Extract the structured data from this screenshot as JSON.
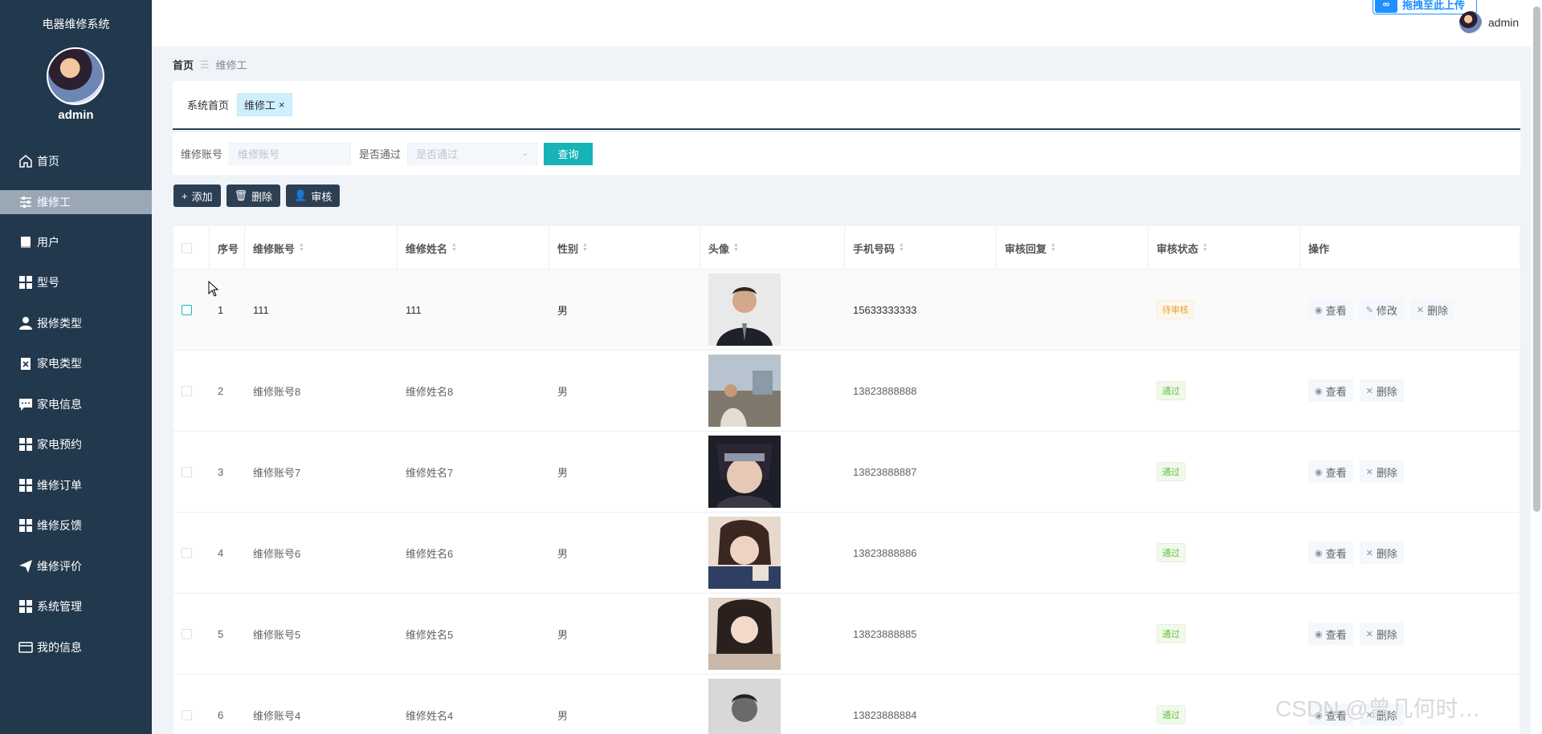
{
  "sidebar": {
    "title": "电器维修系统",
    "username": "admin",
    "items": [
      {
        "label": "首页",
        "icon": "home-icon"
      },
      {
        "label": "维修工",
        "icon": "sliders-icon"
      },
      {
        "label": "用户",
        "icon": "book-icon"
      },
      {
        "label": "型号",
        "icon": "grid-icon"
      },
      {
        "label": "报修类型",
        "icon": "user-icon"
      },
      {
        "label": "家电类型",
        "icon": "clipboard-icon"
      },
      {
        "label": "家电信息",
        "icon": "chat-icon"
      },
      {
        "label": "家电预约",
        "icon": "grid-icon"
      },
      {
        "label": "维修订单",
        "icon": "grid-icon"
      },
      {
        "label": "维修反馈",
        "icon": "grid-icon"
      },
      {
        "label": "维修评价",
        "icon": "send-icon"
      },
      {
        "label": "系统管理",
        "icon": "grid-icon"
      },
      {
        "label": "我的信息",
        "icon": "card-icon"
      }
    ],
    "active_index": 1
  },
  "topbar": {
    "upload_text": "拖拽至此上传",
    "username": "admin"
  },
  "breadcrumb": {
    "home": "首页",
    "current": "维修工"
  },
  "tabs": [
    {
      "label": "系统首页",
      "active": false
    },
    {
      "label": "维修工",
      "active": true
    }
  ],
  "search": {
    "account_label": "维修账号",
    "account_placeholder": "维修账号",
    "pass_label": "是否通过",
    "pass_placeholder": "是否通过",
    "query_label": "查询"
  },
  "actions": {
    "add": "添加",
    "delete": "删除",
    "review": "审核"
  },
  "table": {
    "columns": [
      "序号",
      "维修账号",
      "维修姓名",
      "性别",
      "头像",
      "手机号码",
      "审核回复",
      "审核状态",
      "操作"
    ],
    "view_label": "查看",
    "edit_label": "修改",
    "delete_label": "删除",
    "rows": [
      {
        "index": "1",
        "account": "111",
        "name": "111",
        "gender": "男",
        "phone": "15633333333",
        "reply": "",
        "status": "待审核",
        "status_type": "pending"
      },
      {
        "index": "2",
        "account": "维修账号8",
        "name": "维修姓名8",
        "gender": "男",
        "phone": "13823888888",
        "reply": "",
        "status": "通过",
        "status_type": "passed"
      },
      {
        "index": "3",
        "account": "维修账号7",
        "name": "维修姓名7",
        "gender": "男",
        "phone": "13823888887",
        "reply": "",
        "status": "通过",
        "status_type": "passed"
      },
      {
        "index": "4",
        "account": "维修账号6",
        "name": "维修姓名6",
        "gender": "男",
        "phone": "13823888886",
        "reply": "",
        "status": "通过",
        "status_type": "passed"
      },
      {
        "index": "5",
        "account": "维修账号5",
        "name": "维修姓名5",
        "gender": "男",
        "phone": "13823888885",
        "reply": "",
        "status": "通过",
        "status_type": "passed"
      },
      {
        "index": "6",
        "account": "维修账号4",
        "name": "维修姓名4",
        "gender": "男",
        "phone": "13823888884",
        "reply": "",
        "status": "通过",
        "status_type": "passed"
      }
    ]
  },
  "watermark": "CSDN @曾几何时…"
}
